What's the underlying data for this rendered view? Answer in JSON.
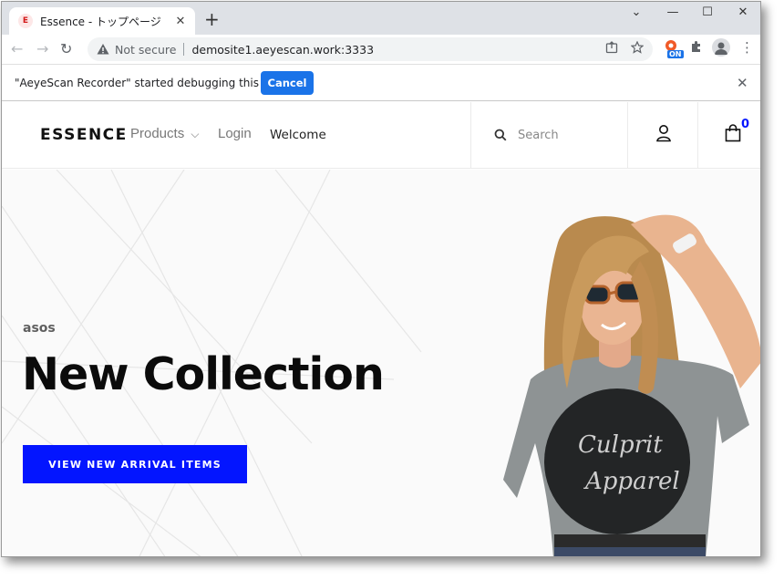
{
  "browser": {
    "tab": {
      "favicon_letter": "E",
      "title": "Essence - トップページ",
      "close": "✕"
    },
    "new_tab": "+",
    "window_controls": {
      "minimize": "—",
      "maximize": "☐",
      "close": "✕",
      "tab_search": "⌄"
    },
    "nav": {
      "back": "←",
      "forward": "→",
      "reload": "↻"
    },
    "address": {
      "security_label": "Not secure",
      "url": "demosite1.aeyescan.work:3333"
    },
    "extension_badge": "ON",
    "menu_icon": "⋮"
  },
  "infobar": {
    "message": "\"AeyeScan Recorder\" started debugging this browser",
    "cancel_label": "Cancel",
    "close": "✕"
  },
  "site": {
    "logo": "ESSENCE",
    "nav": {
      "products": "Products",
      "products_caret": "⌵",
      "login": "Login",
      "welcome": "Welcome"
    },
    "search": {
      "placeholder": "Search"
    },
    "cart_count": "0"
  },
  "hero": {
    "eyebrow": "asos",
    "title": "New Collection",
    "cta_label": "VIEW NEW ARRIVAL ITEMS",
    "shirt_text": [
      "Culprit",
      "Apparel"
    ]
  },
  "colors": {
    "accent": "#0315ff",
    "chrome_blue": "#1a73e8",
    "tabstrip": "#dee1e6"
  }
}
